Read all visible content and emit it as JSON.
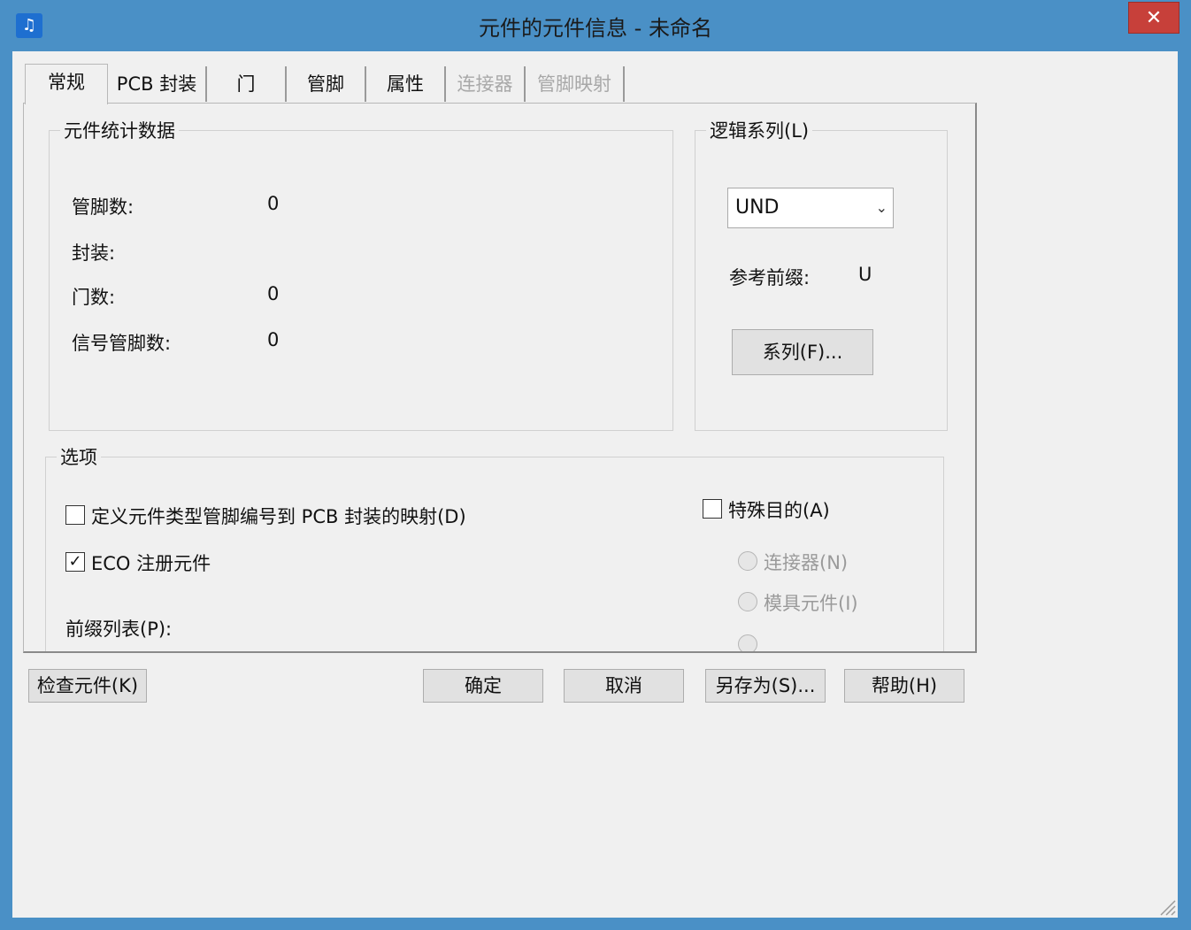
{
  "title": "元件的元件信息 - 未命名",
  "app_icon_glyph": "♫",
  "close_glyph": "✕",
  "tabs": [
    {
      "label": "常规",
      "disabled": false
    },
    {
      "label": "PCB 封装",
      "disabled": false
    },
    {
      "label": "门",
      "disabled": false
    },
    {
      "label": "管脚",
      "disabled": false
    },
    {
      "label": "属性",
      "disabled": false
    },
    {
      "label": "连接器",
      "disabled": true
    },
    {
      "label": "管脚映射",
      "disabled": true
    }
  ],
  "stats": {
    "title": "元件统计数据",
    "rows": [
      {
        "label": "管脚数:",
        "value": "0"
      },
      {
        "label": "封装:",
        "value": ""
      },
      {
        "label": "门数:",
        "value": "0"
      },
      {
        "label": "信号管脚数:",
        "value": "0"
      }
    ]
  },
  "logic": {
    "title": "逻辑系列(L)",
    "selected": "UND",
    "prefix_label": "参考前缀:",
    "prefix_value": "U",
    "family_button": "系列(F)..."
  },
  "options": {
    "title": "选项",
    "define_mapping": {
      "label": "定义元件类型管脚编号到 PCB 封装的映射(D)",
      "checked": false
    },
    "eco_register": {
      "label": "ECO 注册元件",
      "checked": true
    },
    "prefix_list_label": "前缀列表(P):",
    "special_purpose": {
      "label": "特殊目的(A)",
      "checked": false
    },
    "radios": [
      {
        "label": "连接器(N)"
      },
      {
        "label": "模具元件(I)"
      }
    ]
  },
  "buttons": {
    "check": "检查元件(K)",
    "ok": "确定",
    "cancel": "取消",
    "save_as": "另存为(S)...",
    "help": "帮助(H)"
  },
  "colors": {
    "titlebar": "#4a90c6",
    "close": "#c7403a",
    "client": "#f0f0f0"
  }
}
